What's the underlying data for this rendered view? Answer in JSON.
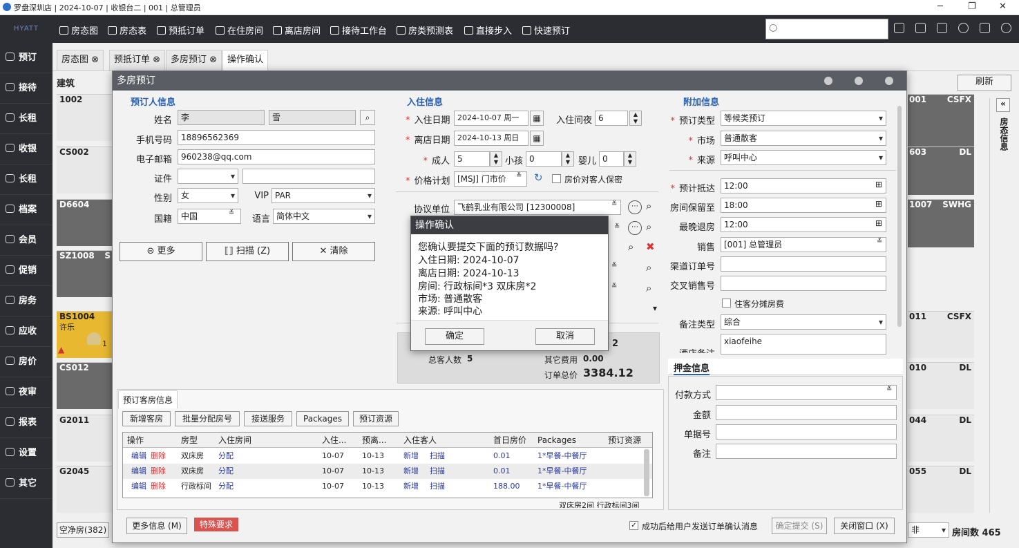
{
  "window": {
    "title": "罗盘深圳店 | 2024-10-07 | 收银台二 | 001 | 总管理员",
    "minimize": "─",
    "restore": "❐",
    "close": "✕"
  },
  "brand": "HYATT",
  "topnav": [
    {
      "label": "房态图"
    },
    {
      "label": "房态表"
    },
    {
      "label": "预抵订单"
    },
    {
      "label": "在住房间"
    },
    {
      "label": "离店房间"
    },
    {
      "label": "接待工作台"
    },
    {
      "label": "房类预测表"
    },
    {
      "label": "直接步入"
    },
    {
      "label": "快速预订"
    }
  ],
  "sidebar": [
    {
      "label": "预订"
    },
    {
      "label": "接待"
    },
    {
      "label": "长租"
    },
    {
      "label": "收银"
    },
    {
      "label": "长租"
    },
    {
      "label": "档案"
    },
    {
      "label": "会员"
    },
    {
      "label": "促销"
    },
    {
      "label": "房务"
    },
    {
      "label": "应收"
    },
    {
      "label": "房价"
    },
    {
      "label": "夜审"
    },
    {
      "label": "报表"
    },
    {
      "label": "设置"
    },
    {
      "label": "其它"
    }
  ],
  "tabs": [
    {
      "label": "房态图 ⊗"
    },
    {
      "label": "预抵订单 ⊗"
    },
    {
      "label": "多房预订 ⊗"
    },
    {
      "label": "操作确认"
    }
  ],
  "bg": {
    "building_label": "建筑",
    "refresh": "刷新",
    "side_panel": "房态信息",
    "collapse": "«",
    "left_rooms": [
      {
        "code": "1002"
      },
      {
        "code": "CS002"
      },
      {
        "code": "D6604"
      },
      {
        "code": "SZ1008",
        "extra": "S"
      },
      {
        "code": "BS1004",
        "guest": "许乐",
        "count": "1"
      },
      {
        "code": "CS012"
      },
      {
        "code": "G2011"
      },
      {
        "code": "G2045"
      }
    ],
    "right_rooms": [
      {
        "code": "001",
        "tag": "CSFX"
      },
      {
        "code": "603",
        "tag": "DL"
      },
      {
        "code": "1007",
        "tag": "SWHG"
      },
      {
        "code": "011",
        "tag": "CSFX"
      },
      {
        "code": "010",
        "tag": "DL"
      },
      {
        "code": "044",
        "tag": "DL"
      },
      {
        "code": "055",
        "tag": "DL"
      }
    ],
    "footer_left": "空净房(382)",
    "footer_right_suffix": "非",
    "room_count": "房间数 465"
  },
  "dialog": {
    "title": "多房预订",
    "booker": {
      "section": "预订人信息",
      "name_label": "姓名",
      "surname": "李",
      "given": "雪",
      "phone_label": "手机号码",
      "phone": "18896562369",
      "email_label": "电子邮箱",
      "email": "960238@qq.com",
      "id_label": "证件",
      "id_type": "",
      "id_no": "",
      "gender_label": "性别",
      "gender": "女",
      "vip_label": "VIP",
      "vip": "PAR",
      "country_label": "国籍",
      "country": "中国",
      "lang_label": "语言",
      "lang": "简体中文",
      "more": "⊝ 更多",
      "scan": "⟦⟧ 扫描 (Z)",
      "clear": "✕ 清除"
    },
    "stay": {
      "section": "入住信息",
      "checkin_label": "入住日期",
      "checkin": "2024-10-07 周一",
      "nights_label": "入住间夜",
      "nights": "6",
      "checkout_label": "离店日期",
      "checkout": "2024-10-13 周日",
      "adult_label": "成人",
      "adult": "5",
      "child_label": "小孩",
      "child": "0",
      "infant_label": "婴儿",
      "infant": "0",
      "rateplan_label": "价格计划",
      "rateplan": "[MSJ] 门市价",
      "secret_label": "房价对客人保密",
      "agreement_label": "协议单位",
      "agreement": "飞鹤乳业有限公司 [12300008]",
      "total_guests_label": "总客人数",
      "total_guests": "5",
      "other_fee_label": "其它费用",
      "other_fee": "0.00",
      "order_total_label": "订单总价",
      "order_total": "3384.12",
      "partial_digit": "2"
    },
    "extra": {
      "section": "附加信息",
      "type_label": "预订类型",
      "type": "等候类预订",
      "market_label": "市场",
      "market": "普通散客",
      "source_label": "来源",
      "source": "呼叫中心",
      "arrive_label": "预计抵达",
      "arrive": "12:00",
      "hold_label": "房间保留至",
      "hold": "18:00",
      "late_label": "最晚退房",
      "late": "12:00",
      "sales_label": "销售",
      "sales": "[001] 总管理员",
      "channel_label": "渠道订单号",
      "channel": "",
      "cross_label": "交叉销售号",
      "cross": "",
      "split_label": "住客分摊房费",
      "remark_type_label": "备注类型",
      "remark_type": "综合",
      "hotel_remark_label": "酒店备注",
      "hotel_remark": "xiaofeihe"
    },
    "deposit": {
      "section": "押金信息",
      "pay_label": "付款方式",
      "amount_label": "金额",
      "doc_label": "单据号",
      "note_label": "备注"
    },
    "rooms": {
      "tab": "预订客房信息",
      "buttons": [
        "新增客房",
        "批量分配房号",
        "接送服务",
        "Packages",
        "预订资源"
      ],
      "headers": [
        "操作",
        "房型",
        "入住房间",
        "入住...",
        "预离...",
        "入住客人",
        "首日房价",
        "Packages",
        "预订资源"
      ],
      "rows": [
        {
          "edit": "编辑",
          "del": "删除",
          "type": "双床房",
          "assign": "分配",
          "in": "10-07",
          "out": "10-13",
          "add": "新增",
          "scan": "扫描",
          "price": "0.01",
          "pkg": "1*早餐-中餐厅"
        },
        {
          "edit": "编辑",
          "del": "删除",
          "type": "双床房",
          "assign": "分配",
          "in": "10-07",
          "out": "10-13",
          "add": "新增",
          "scan": "扫描",
          "price": "0.01",
          "pkg": "1*早餐-中餐厅"
        },
        {
          "edit": "编辑",
          "del": "删除",
          "type": "行政标间",
          "assign": "分配",
          "in": "10-07",
          "out": "10-13",
          "add": "新增",
          "scan": "扫描",
          "price": "188.00",
          "pkg": "1*早餐-中餐厅"
        }
      ],
      "summary": "双床房2间 行政标间3间"
    },
    "footer": {
      "more_info": "更多信息 (M)",
      "special": "特殊要求",
      "notify": "成功后给用户发送订单确认消息",
      "submit": "确定提交 (S)",
      "close": "关闭窗口 (X)"
    }
  },
  "confirm": {
    "title": "操作确认",
    "question": "您确认要提交下面的预订数据吗?",
    "lines": [
      "入住日期: 2024-10-07",
      "离店日期: 2024-10-13",
      "房间: 行政标间*3 双床房*2",
      "市场: 普通散客",
      "来源: 呼叫中心"
    ],
    "ok": "确定",
    "cancel": "取消"
  }
}
